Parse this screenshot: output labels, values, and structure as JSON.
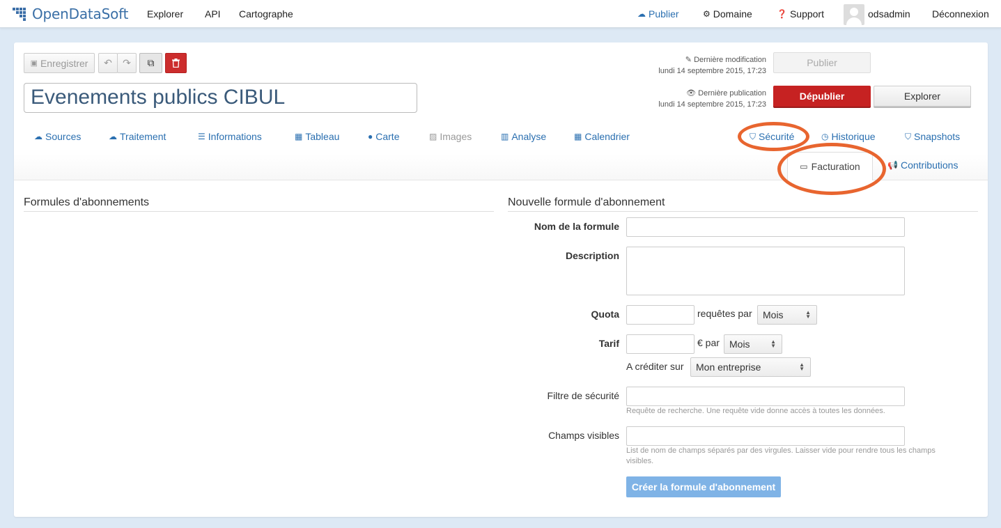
{
  "topnav": {
    "brand": "OpenDataSoft",
    "left_links": [
      "Explorer",
      "API",
      "Cartographe"
    ],
    "publish": "Publier",
    "domain": "Domaine",
    "support": "Support",
    "user": "odsadmin",
    "logout": "Déconnexion"
  },
  "toolbar": {
    "save": "Enregistrer"
  },
  "dataset_title": "Evenements publics CIBUL",
  "meta": {
    "last_modified_label": "Dernière modification",
    "last_modified_date": "lundi 14 septembre 2015, 17:23",
    "last_published_label": "Dernière publication",
    "last_published_date": "lundi 14 septembre 2015, 17:23"
  },
  "actions": {
    "publish": "Publier",
    "unpublish": "Dépublier",
    "explore": "Explorer"
  },
  "tabs": {
    "sources": "Sources",
    "traitement": "Traitement",
    "informations": "Informations",
    "tableau": "Tableau",
    "carte": "Carte",
    "images": "Images",
    "analyse": "Analyse",
    "calendrier": "Calendrier",
    "securite": "Sécurité",
    "historique": "Historique",
    "snapshots": "Snapshots",
    "facturation": "Facturation",
    "contributions": "Contributions"
  },
  "left_section": {
    "title": "Formules d'abonnements"
  },
  "form": {
    "title": "Nouvelle formule d'abonnement",
    "name_label": "Nom de la formule",
    "description_label": "Description",
    "quota_label": "Quota",
    "quota_per": "requêtes par",
    "quota_period": "Mois",
    "tarif_label": "Tarif",
    "tarif_per": "€ par",
    "tarif_period": "Mois",
    "credit_label": "A créditer sur",
    "credit_value": "Mon entreprise",
    "filter_label": "Filtre de sécurité",
    "filter_help": "Requête de recherche. Une requête vide donne accès à toutes les données.",
    "fields_label": "Champs visibles",
    "fields_help_1": "List de nom de champs séparés par des virgules. Laisser vide pour rendre tous les champs",
    "fields_help_2": "visibles.",
    "submit": "Créer la formule d'abonnement"
  },
  "colors": {
    "accent_link": "#2a6fb0",
    "danger": "#c62222",
    "highlight_ring": "#e8652f",
    "primary_disabled": "#7fb3e6"
  }
}
